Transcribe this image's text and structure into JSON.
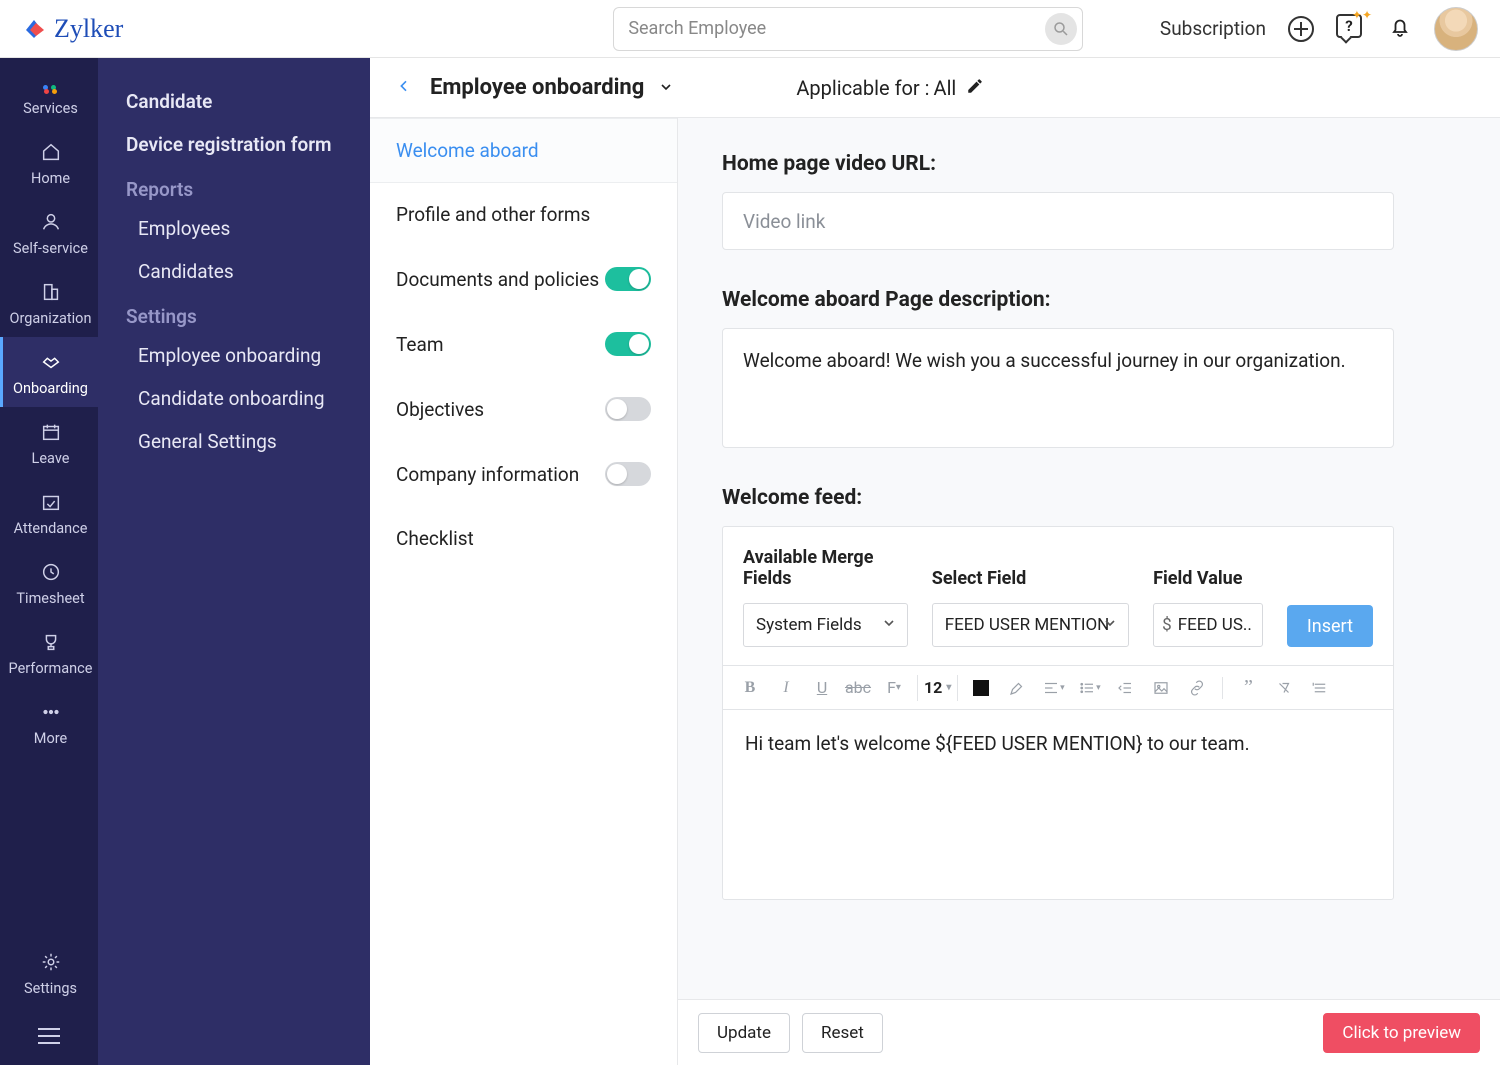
{
  "brand": "Zylker",
  "search_placeholder": "Search Employee",
  "top": {
    "subscription": "Subscription"
  },
  "rail": [
    {
      "id": "services",
      "label": "Services"
    },
    {
      "id": "home",
      "label": "Home"
    },
    {
      "id": "selfservice",
      "label": "Self-service"
    },
    {
      "id": "organization",
      "label": "Organization"
    },
    {
      "id": "onboarding",
      "label": "Onboarding"
    },
    {
      "id": "leave",
      "label": "Leave"
    },
    {
      "id": "attendance",
      "label": "Attendance"
    },
    {
      "id": "timesheet",
      "label": "Timesheet"
    },
    {
      "id": "performance",
      "label": "Performance"
    },
    {
      "id": "more",
      "label": "More"
    },
    {
      "id": "settings",
      "label": "Settings"
    }
  ],
  "nav2": {
    "top_links": [
      "Candidate",
      "Device registration form"
    ],
    "reports_head": "Reports",
    "reports": [
      "Employees",
      "Candidates"
    ],
    "settings_head": "Settings",
    "settings": [
      "Employee onboarding",
      "Candidate onboarding",
      "General Settings"
    ]
  },
  "page": {
    "title": "Employee onboarding",
    "applicable_prefix": "Applicable for :",
    "applicable_value": "All"
  },
  "steps": [
    {
      "label": "Welcome aboard",
      "toggle": null,
      "active": true
    },
    {
      "label": "Profile and other forms",
      "toggle": null
    },
    {
      "label": "Documents and policies",
      "toggle": true
    },
    {
      "label": "Team",
      "toggle": true
    },
    {
      "label": "Objectives",
      "toggle": false
    },
    {
      "label": "Company information",
      "toggle": false
    },
    {
      "label": "Checklist",
      "toggle": null
    }
  ],
  "form": {
    "video_label": "Home page video URL:",
    "video_placeholder": "Video link",
    "desc_label": "Welcome aboard Page description:",
    "desc_value": "Welcome aboard! We wish you a successful journey in our organization.",
    "feed_label": "Welcome feed:",
    "merge": {
      "h1": "Available Merge Fields",
      "h2": "Select Field",
      "h3": "Field Value",
      "sel1": "System Fields",
      "sel2": "FEED USER MENTION",
      "fv": "FEED US..",
      "insert": "Insert"
    },
    "font_size": "12",
    "editor_text": "Hi team let's welcome ${FEED USER MENTION} to our team."
  },
  "footer": {
    "update": "Update",
    "reset": "Reset",
    "preview": "Click to preview"
  }
}
